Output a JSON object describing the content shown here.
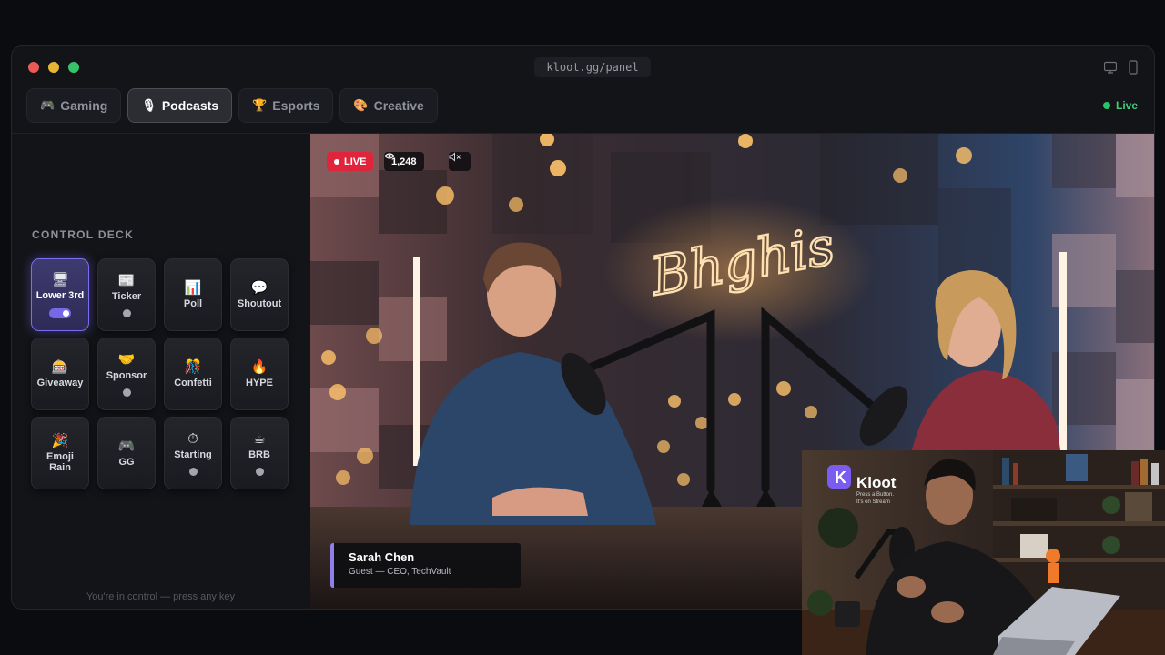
{
  "window": {
    "url": "kloot.gg/panel"
  },
  "tabs": [
    {
      "label": "Gaming",
      "icon": "gamepad-icon"
    },
    {
      "label": "Podcasts",
      "icon": "microphone-icon",
      "active": true
    },
    {
      "label": "Esports",
      "icon": "trophy-icon"
    },
    {
      "label": "Creative",
      "icon": "palette-icon"
    }
  ],
  "status": {
    "label": "Live",
    "color": "#3ecf7a"
  },
  "deck": {
    "title": "CONTROL DECK",
    "hint": "You're in control — press any key",
    "keys": [
      {
        "label": "Lower 3rd",
        "icon": "lower-third-icon",
        "active": true,
        "state": "on"
      },
      {
        "label": "Ticker",
        "icon": "ticker-icon",
        "state": "off"
      },
      {
        "label": "Poll",
        "icon": "chart-icon"
      },
      {
        "label": "Shoutout",
        "icon": "speech-bubble-icon"
      },
      {
        "label": "Giveaway",
        "icon": "gift-icon"
      },
      {
        "label": "Sponsor",
        "icon": "handshake-icon",
        "state": "off"
      },
      {
        "label": "Confetti",
        "icon": "confetti-icon"
      },
      {
        "label": "HYPE",
        "icon": "fire-icon"
      },
      {
        "label": "Emoji Rain",
        "icon": "party-popper-icon"
      },
      {
        "label": "GG",
        "icon": "controller-icon"
      },
      {
        "label": "Starting",
        "icon": "stopwatch-icon",
        "state": "off"
      },
      {
        "label": "BRB",
        "icon": "coffee-icon",
        "state": "off"
      }
    ]
  },
  "stream": {
    "live_label": "LIVE",
    "viewers": "1,248",
    "neon_sign": "Bhghis",
    "lower_third": {
      "name": "Sarah Chen",
      "role": "Guest — CEO, TechVault"
    }
  },
  "pip": {
    "brand": "Kloot",
    "tagline_1": "Press a Button.",
    "tagline_2": "It's on Stream"
  },
  "colors": {
    "accent": "#7668e8",
    "live_red": "#e0243c",
    "live_green": "#28c46a"
  }
}
